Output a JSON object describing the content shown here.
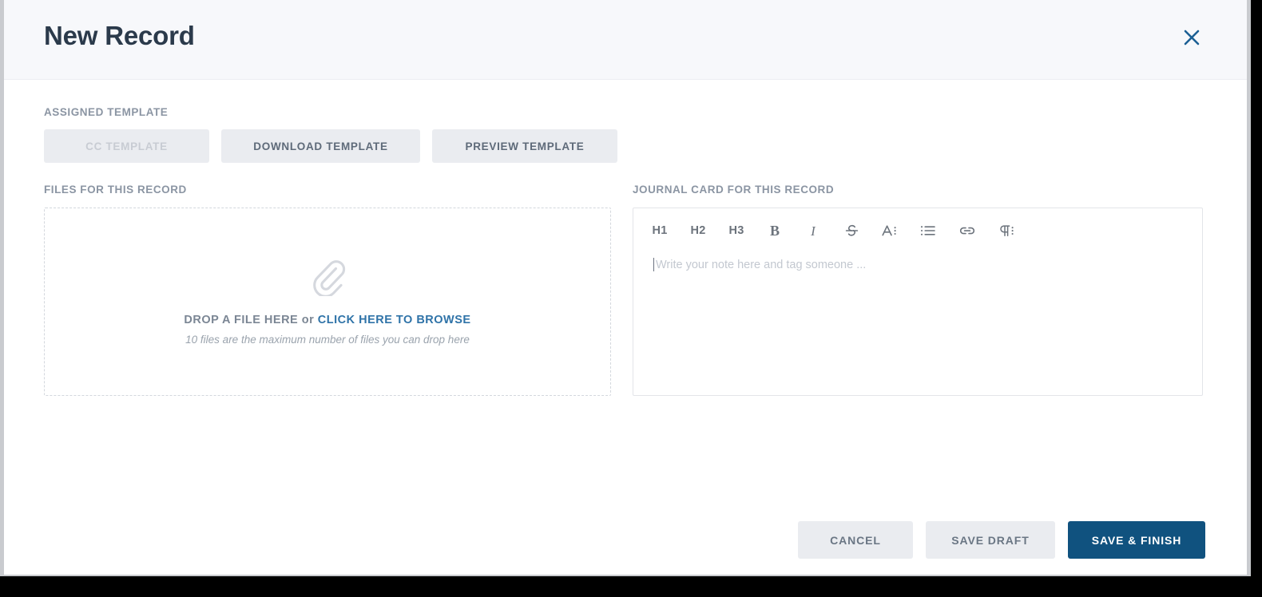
{
  "window": {
    "title": "New Record",
    "close_icon": "close-icon"
  },
  "assigned_template": {
    "label": "ASSIGNED TEMPLATE",
    "buttons": [
      {
        "label": "CC TEMPLATE",
        "disabled": true
      },
      {
        "label": "DOWNLOAD TEMPLATE",
        "disabled": false
      },
      {
        "label": "PREVIEW TEMPLATE",
        "disabled": false
      }
    ]
  },
  "files": {
    "label": "FILES FOR THIS RECORD",
    "dropzone": {
      "icon": "paperclip-icon",
      "prompt_prefix": "DROP A FILE HERE",
      "prompt_separator": " or ",
      "prompt_link": "CLICK HERE TO BROWSE",
      "hint": "10 files are the maximum number of files you can drop here"
    }
  },
  "journal": {
    "label": "JOURNAL CARD FOR THIS RECORD",
    "toolbar": [
      {
        "name": "heading-1-button",
        "label": "H1"
      },
      {
        "name": "heading-2-button",
        "label": "H2"
      },
      {
        "name": "heading-3-button",
        "label": "H3"
      },
      {
        "name": "bold-button",
        "label": "B"
      },
      {
        "name": "italic-button",
        "label": "I"
      },
      {
        "name": "strikethrough-icon",
        "label": "S"
      },
      {
        "name": "text-style-icon",
        "label": "A"
      },
      {
        "name": "bullet-list-icon",
        "label": "list"
      },
      {
        "name": "link-icon",
        "label": "link"
      },
      {
        "name": "paragraph-style-icon",
        "label": "¶"
      }
    ],
    "editor": {
      "value": "",
      "placeholder": "Write your note here and tag someone ..."
    }
  },
  "footer": {
    "cancel_label": "CANCEL",
    "save_draft_label": "SAVE DRAFT",
    "save_finish_label": "SAVE & FINISH"
  },
  "colors": {
    "header_bg": "#f7f8fb",
    "title": "#2b3a4b",
    "close": "#1b5f94",
    "label": "#8b95a3",
    "button_bg": "#eaecf0",
    "button_text": "#5e6a79",
    "button_disabled_text": "#c8ccd3",
    "link": "#2f73a8",
    "primary": "#10527f",
    "dropzone_border": "#d3d7dd",
    "editor_border": "#e3e5e9"
  }
}
